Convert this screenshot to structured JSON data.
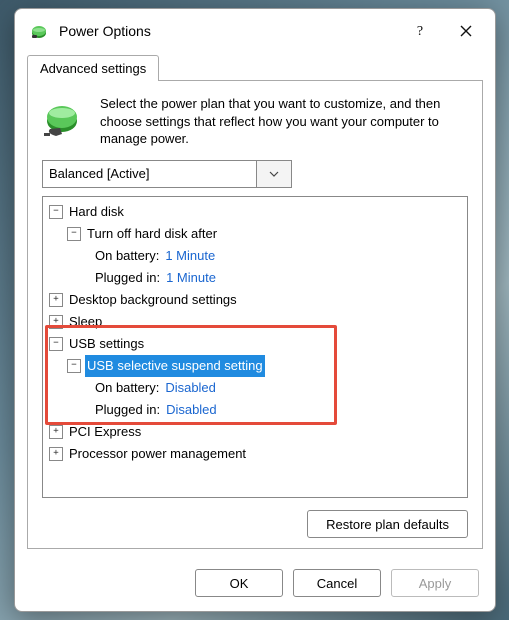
{
  "title": "Power Options",
  "tab_label": "Advanced settings",
  "intro_text": "Select the power plan that you want to customize, and then choose settings that reflect how you want your computer to manage power.",
  "plan_selected": "Balanced [Active]",
  "tree": {
    "hard_disk": "Hard disk",
    "turn_off": "Turn off hard disk after",
    "hd_on_battery_label": "On battery:",
    "hd_on_battery_value": "1 Minute",
    "hd_plugged_label": "Plugged in:",
    "hd_plugged_value": "1 Minute",
    "desktop_bg": "Desktop background settings",
    "sleep": "Sleep",
    "usb_settings": "USB settings",
    "usb_suspend": "USB selective suspend setting",
    "usb_on_battery_label": "On battery:",
    "usb_on_battery_value": "Disabled",
    "usb_plugged_label": "Plugged in:",
    "usb_plugged_value": "Disabled",
    "pci": "PCI Express",
    "proc": "Processor power management"
  },
  "restore_label": "Restore plan defaults",
  "ok_label": "OK",
  "cancel_label": "Cancel",
  "apply_label": "Apply"
}
